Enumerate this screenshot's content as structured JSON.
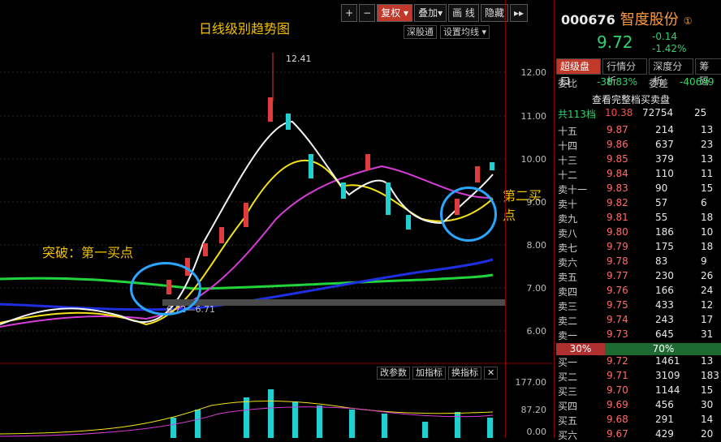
{
  "header": {
    "title": "日线级别趋势图",
    "toolbar": [
      "+",
      "−",
      "复权 ▾",
      "叠加▾",
      "画 线",
      "隐藏",
      "▸▸"
    ],
    "subbar": [
      "深股通",
      "设置均线 ▾"
    ]
  },
  "labels": {
    "first_buy": "突破：第一买点",
    "second_buy": "第二买点"
  },
  "axis": {
    "prices": [
      "12.00",
      "11.00",
      "10.00",
      "9.00",
      "8.00",
      "7.00",
      "6.00"
    ],
    "volume": [
      "177.00",
      "87.20",
      "0.00"
    ],
    "marker": "12.41",
    "low": "6.72—6.71"
  },
  "vol_tools": [
    "改参数",
    "加指标",
    "换指标",
    "✕"
  ],
  "side": {
    "code": "000676",
    "name": "智度股份",
    "badge": "①",
    "price": "9.72",
    "change": "-0.14",
    "pct": "-1.42%",
    "tabs": [
      "超级盘口",
      "行情分析",
      "深度分析",
      "筹码"
    ],
    "ratio": {
      "label": "委比",
      "value": "-38.83%",
      "diff_label": "委差",
      "diff": "-40699"
    },
    "note": "查看完整档买卖盘",
    "summary": {
      "label": "共113档",
      "price": "10.38",
      "vol": "72754",
      "count": "25"
    },
    "asks": [
      [
        "十五",
        "9.87",
        "214",
        "13"
      ],
      [
        "十四",
        "9.86",
        "637",
        "23"
      ],
      [
        "十三",
        "9.85",
        "379",
        "13"
      ],
      [
        "十二",
        "9.84",
        "110",
        "11"
      ],
      [
        "卖十一",
        "9.83",
        "90",
        "15"
      ],
      [
        "卖十",
        "9.82",
        "57",
        "6"
      ],
      [
        "卖九",
        "9.81",
        "55",
        "18"
      ],
      [
        "卖八",
        "9.80",
        "186",
        "10"
      ],
      [
        "卖七",
        "9.79",
        "175",
        "18"
      ],
      [
        "卖六",
        "9.78",
        "83",
        "9"
      ],
      [
        "卖五",
        "9.77",
        "230",
        "26"
      ],
      [
        "卖四",
        "9.76",
        "166",
        "24"
      ],
      [
        "卖三",
        "9.75",
        "433",
        "12"
      ],
      [
        "卖二",
        "9.74",
        "243",
        "17"
      ],
      [
        "卖一",
        "9.73",
        "645",
        "31"
      ]
    ],
    "split": [
      "30%",
      "70%"
    ],
    "bids": [
      [
        "买一",
        "9.72",
        "1461",
        "13"
      ],
      [
        "买二",
        "9.71",
        "3109",
        "183"
      ],
      [
        "买三",
        "9.70",
        "1144",
        "15"
      ],
      [
        "买四",
        "9.69",
        "456",
        "30"
      ],
      [
        "买五",
        "9.68",
        "291",
        "14"
      ],
      [
        "买六",
        "9.67",
        "429",
        "20"
      ]
    ]
  }
}
